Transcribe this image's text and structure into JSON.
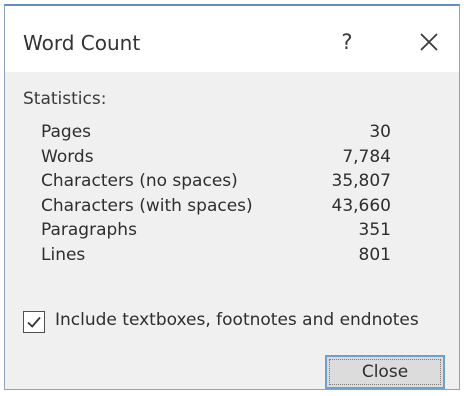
{
  "dialog": {
    "title": "Word Count",
    "help_label": "?",
    "section_label": "Statistics:",
    "statistics": [
      {
        "label": "Pages",
        "value": "30"
      },
      {
        "label": "Words",
        "value": "7,784"
      },
      {
        "label": "Characters (no spaces)",
        "value": "35,807"
      },
      {
        "label": "Characters (with spaces)",
        "value": "43,660"
      },
      {
        "label": "Paragraphs",
        "value": "351"
      },
      {
        "label": "Lines",
        "value": "801"
      }
    ],
    "include_option": {
      "label": "Include textboxes, footnotes and endnotes",
      "checked": true
    },
    "close_button_label": "Close"
  },
  "colors": {
    "accent": "#6f9fd0",
    "dialog_background": "#f0f0f0"
  },
  "icons": {
    "help": "question-mark",
    "close": "x-close-icon",
    "checkbox": "check-icon"
  }
}
